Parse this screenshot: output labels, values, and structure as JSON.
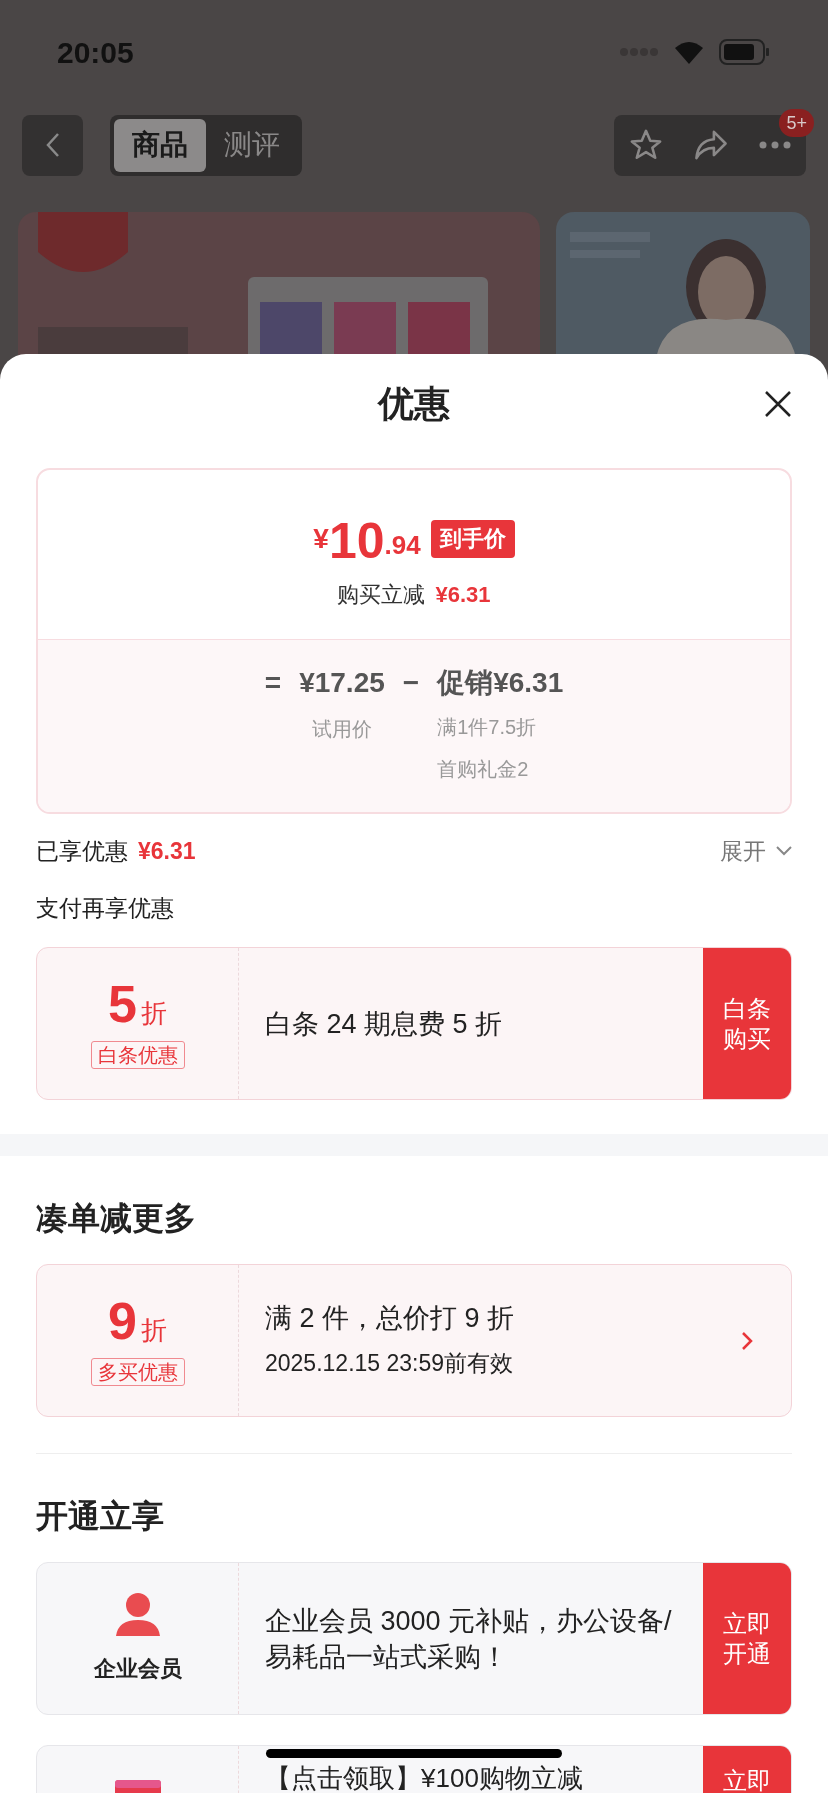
{
  "status_bar": {
    "time": "20:05"
  },
  "nav": {
    "tabs": [
      {
        "label": "商品",
        "selected": true
      },
      {
        "label": "测评",
        "selected": false
      }
    ],
    "badge": "5+"
  },
  "sheet": {
    "title": "优惠",
    "price_card": {
      "currency": "¥",
      "integer": "10",
      "decimal": ".94",
      "tag": "到手价",
      "saving_label": "购买立减",
      "saving": "¥6.31",
      "equals": "=",
      "base_price": "¥17.25",
      "base_label": "试用价",
      "minus": "−",
      "promo": "促销¥6.31",
      "promo_details": [
        "满1件7.5折",
        "首购礼金2"
      ]
    },
    "enjoyed": {
      "label": "已享优惠",
      "amount": "¥6.31",
      "toggle": "展开",
      "expanded": false
    },
    "pay_section": {
      "title": "支付再享优惠",
      "offers": [
        {
          "kind": "discount",
          "value": "5",
          "unit": "折",
          "tag": "白条优惠",
          "lines": [
            "白条 24 期息费 5 折"
          ],
          "action": "白条购买"
        }
      ]
    },
    "bundle_section": {
      "title": "凑单减更多",
      "offers": [
        {
          "kind": "discount",
          "value": "9",
          "unit": "折",
          "tag": "多买优惠",
          "lines": [
            "满 2 件，总价打 9 折",
            "2025.12.15 23:59前有效"
          ]
        }
      ]
    },
    "member_section": {
      "title": "开通立享",
      "offers": [
        {
          "kind": "member",
          "label": "企业会员",
          "lines": [
            "企业会员 3000 元补贴，办公设备/易耗品一站式采购！"
          ],
          "action": "立即开通"
        },
        {
          "kind": "card",
          "lines": [
            "【点击领取】¥100购物立减"
          ],
          "action": "立即"
        }
      ]
    }
  }
}
